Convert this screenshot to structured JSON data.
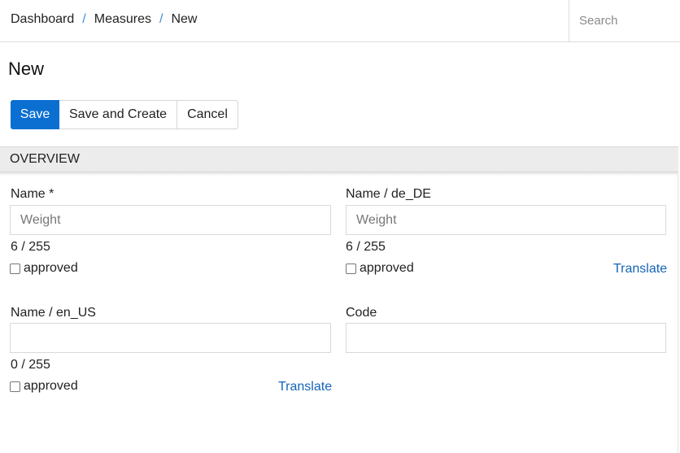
{
  "breadcrumb": {
    "items": [
      "Dashboard",
      "Measures"
    ],
    "separator": "/",
    "current": "New"
  },
  "search": {
    "placeholder": "Search",
    "value": ""
  },
  "page": {
    "title": "New"
  },
  "actions": {
    "save": "Save",
    "save_and_create": "Save and Create",
    "cancel": "Cancel"
  },
  "section": {
    "title": "OVERVIEW"
  },
  "fields": {
    "name": {
      "label": "Name *",
      "value": "",
      "placeholder": "Weight",
      "counter": "6 / 255",
      "approved_label": "approved"
    },
    "name_de": {
      "label": "Name / de_DE",
      "value": "",
      "placeholder": "Weight",
      "counter": "6 / 255",
      "approved_label": "approved",
      "translate_label": "Translate"
    },
    "name_en": {
      "label": "Name / en_US",
      "value": "",
      "placeholder": "",
      "counter": "0 / 255",
      "approved_label": "approved",
      "translate_label": "Translate"
    },
    "code": {
      "label": "Code",
      "value": "",
      "placeholder": ""
    }
  },
  "colors": {
    "primary": "#0b6fd1",
    "link": "#1565b8",
    "breadcrumb_separator": "#3a8fd6",
    "section_bg": "#ececec"
  }
}
